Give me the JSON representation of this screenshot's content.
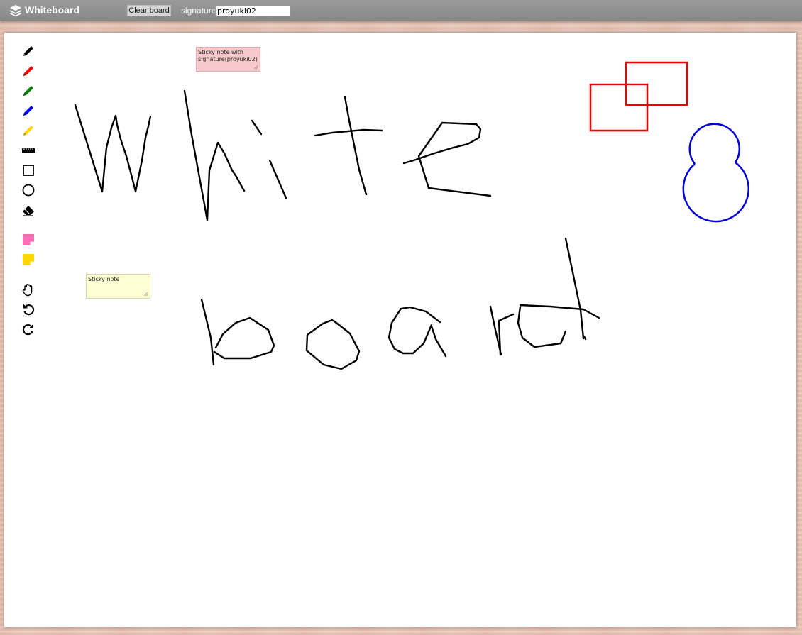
{
  "app": {
    "title": "Whiteboard",
    "logo_icon": "stack-layers-icon"
  },
  "toolbar": {
    "clear_label": "Clear board",
    "signature_label": "signature",
    "signature_value": "proyuki02"
  },
  "tools": [
    {
      "name": "pen-black-icon",
      "color": "#000000"
    },
    {
      "name": "pen-red-icon",
      "color": "#ff0000"
    },
    {
      "name": "pen-green-icon",
      "color": "#008000"
    },
    {
      "name": "pen-blue-icon",
      "color": "#0000ff"
    },
    {
      "name": "pen-yellow-icon",
      "color": "#ffd700"
    },
    {
      "name": "ruler-icon"
    },
    {
      "name": "rectangle-icon"
    },
    {
      "name": "circle-icon"
    },
    {
      "name": "eraser-icon"
    },
    {
      "name": "pink-sticky-note-icon",
      "color": "#ff6eb4"
    },
    {
      "name": "yellow-sticky-note-icon",
      "color": "#ffd700"
    },
    {
      "name": "hand-pan-icon"
    },
    {
      "name": "undo-icon"
    },
    {
      "name": "redo-icon"
    }
  ],
  "notes": [
    {
      "text": "Sticky note with signature(proyuki02)",
      "color": "#f7c9cc"
    },
    {
      "text": "Sticky note",
      "color": "#ffffd6"
    }
  ],
  "stroke_colors": {
    "ink": "#000000",
    "rectangles": "#ee0000",
    "circles": "#0000dd"
  }
}
